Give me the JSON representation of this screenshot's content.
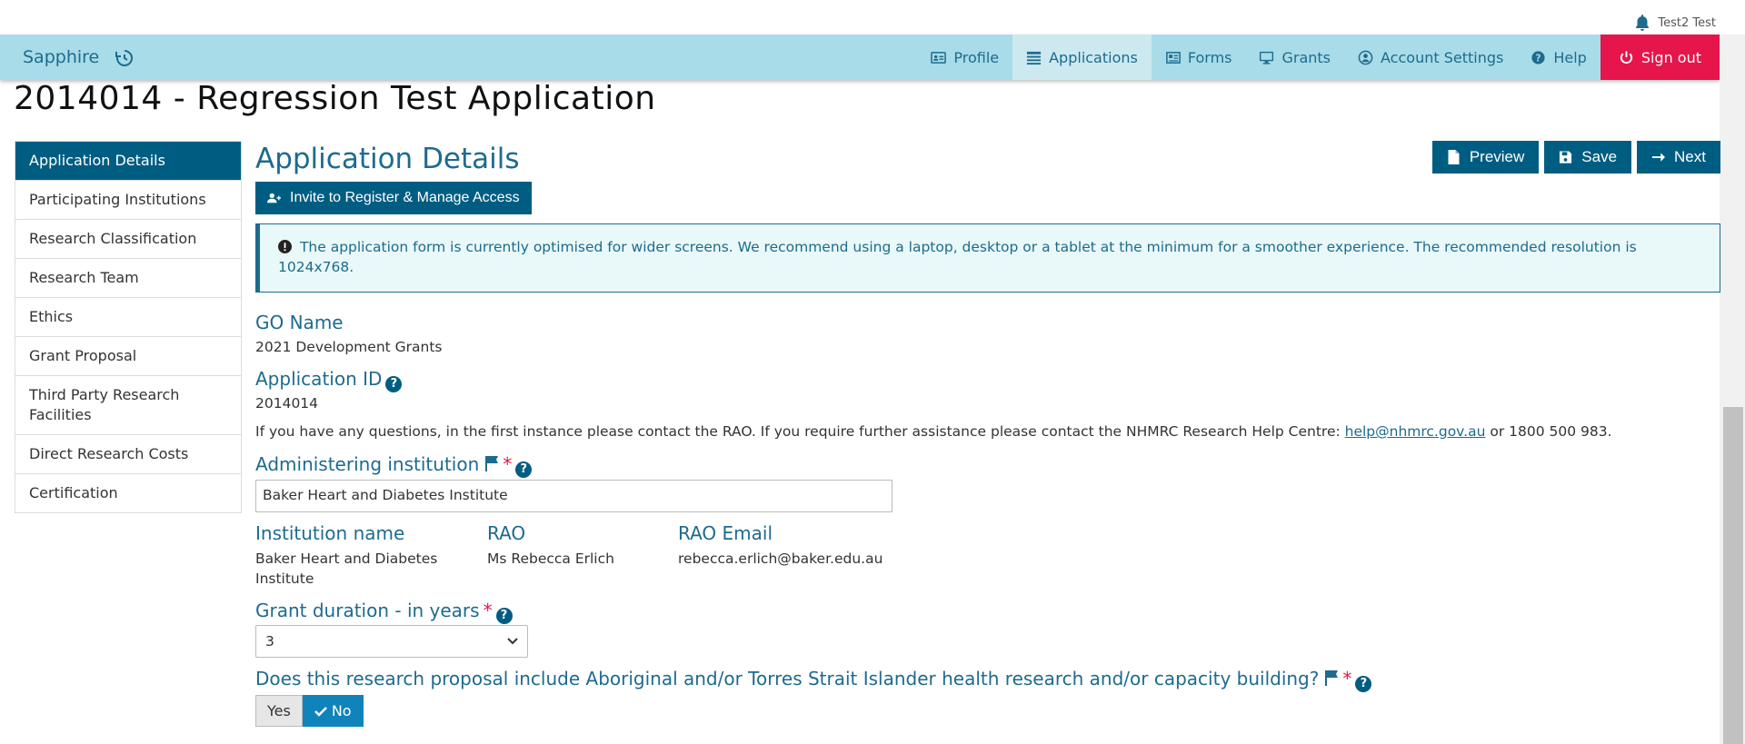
{
  "topbar": {
    "user_name": "Test2 Test"
  },
  "navbar": {
    "brand": "Sapphire",
    "links": [
      {
        "label": "Profile",
        "icon": "id-card-icon"
      },
      {
        "label": "Applications",
        "icon": "list-icon",
        "active": true
      },
      {
        "label": "Forms",
        "icon": "newspaper-icon"
      },
      {
        "label": "Grants",
        "icon": "desktop-icon"
      },
      {
        "label": "Account Settings",
        "icon": "user-circle-icon"
      },
      {
        "label": "Help",
        "icon": "question-circle-icon"
      },
      {
        "label": "Sign out",
        "icon": "power-icon"
      }
    ]
  },
  "page": {
    "title": "2014014 - Regression Test Application"
  },
  "sidebar": {
    "items": [
      {
        "label": "Application Details",
        "active": true
      },
      {
        "label": "Participating Institutions"
      },
      {
        "label": "Research Classification"
      },
      {
        "label": "Research Team"
      },
      {
        "label": "Ethics"
      },
      {
        "label": "Grant Proposal"
      },
      {
        "label": "Third Party Research Facilities"
      },
      {
        "label": "Direct Research Costs"
      },
      {
        "label": "Certification"
      }
    ]
  },
  "main": {
    "heading": "Application Details",
    "buttons": {
      "preview": "Preview",
      "save": "Save",
      "next": "Next",
      "invite": "Invite to Register & Manage Access"
    },
    "alert": "The application form is currently optimised for wider screens. We recommend using a laptop, desktop or a tablet at the minimum for a smoother experience. The recommended resolution is 1024x768.",
    "go_name": {
      "label": "GO Name",
      "value": "2021 Development Grants"
    },
    "application_id": {
      "label": "Application ID",
      "value": "2014014"
    },
    "contact": {
      "text_before": "If you have any questions, in the first instance please contact the RAO. If you require further assistance please contact the NHMRC Research Help Centre: ",
      "email": "help@nhmrc.gov.au",
      "text_after": " or 1800 500 983."
    },
    "administering_institution": {
      "label": "Administering institution",
      "value": "Baker Heart and Diabetes Institute"
    },
    "institution_name": {
      "label": "Institution name",
      "value": "Baker Heart and Diabetes Institute"
    },
    "rao": {
      "label": "RAO",
      "value": "Ms Rebecca Erlich"
    },
    "rao_email": {
      "label": "RAO Email",
      "value": "rebecca.erlich@baker.edu.au"
    },
    "grant_duration": {
      "label": "Grant duration - in years",
      "value": "3"
    },
    "aboriginal_question": {
      "label": "Does this research proposal include Aboriginal and/or Torres Strait Islander health research and/or capacity building?",
      "yes": "Yes",
      "no": "No",
      "selected": "No"
    }
  },
  "colors": {
    "navbar": "#a8dce8",
    "primary": "#005d82",
    "signout": "#e6154b",
    "heading": "#1d6b8e"
  }
}
